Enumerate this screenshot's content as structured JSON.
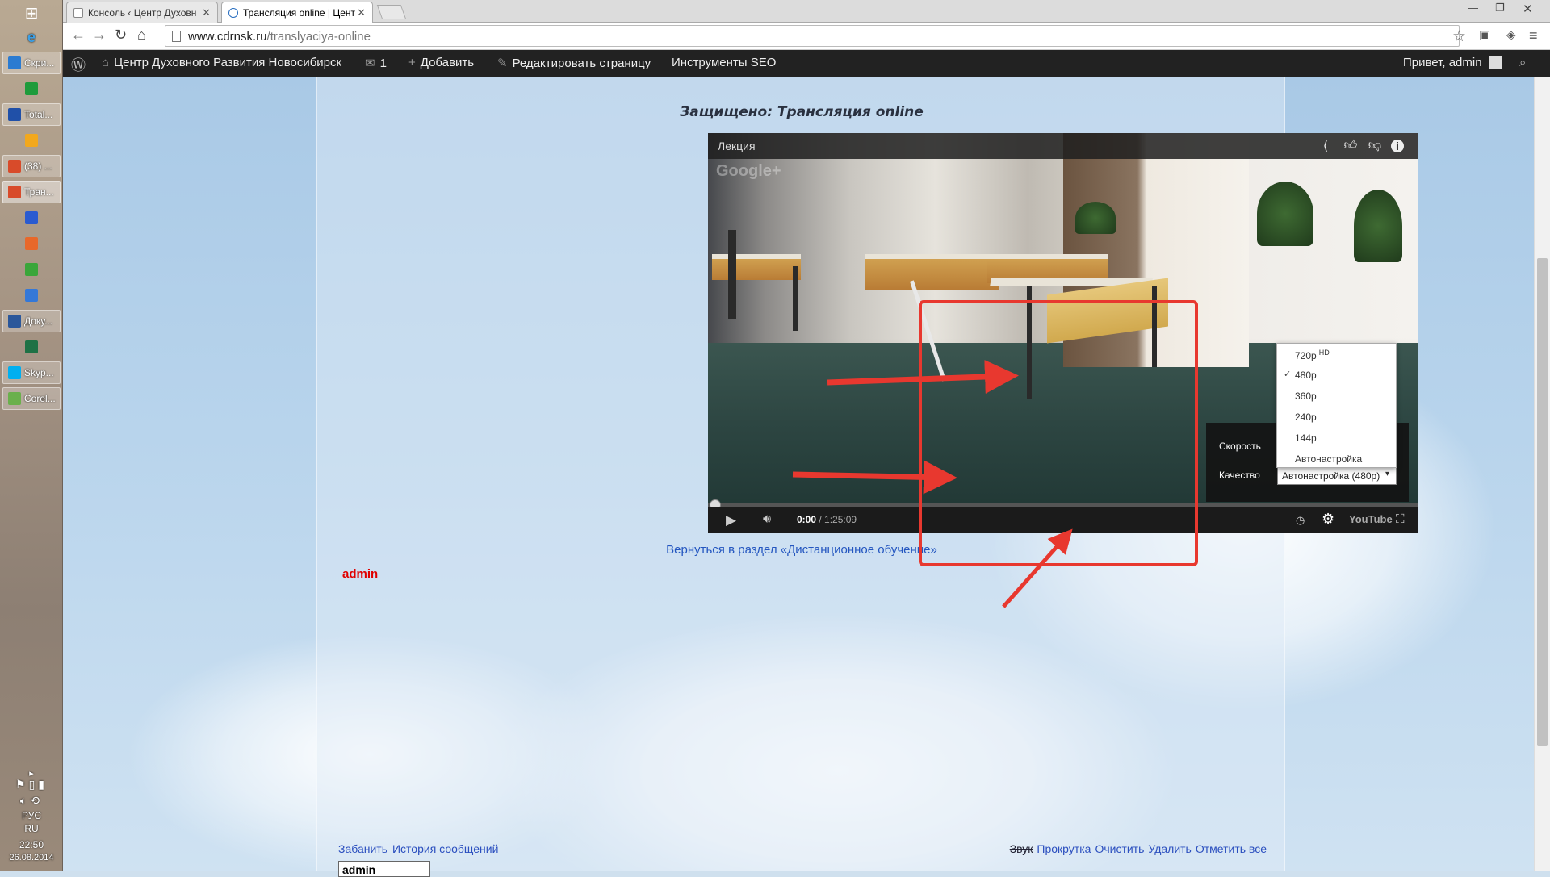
{
  "taskbar": {
    "items": [
      {
        "label": "Скри...",
        "color": "#2b7bd1",
        "button": true
      },
      {
        "label": "",
        "color": "#1e9b3b"
      },
      {
        "label": "Total...",
        "color": "#2050a8",
        "button": true
      },
      {
        "label": "",
        "color": "#f2a81d"
      },
      {
        "label": "(38) ...",
        "color": "#d84b2a",
        "button": true
      },
      {
        "label": "Тран...",
        "color": "#d84b2a",
        "button": true,
        "active": true
      },
      {
        "label": "",
        "color": "#2a5bd0"
      },
      {
        "label": "",
        "color": "#e8682a"
      },
      {
        "label": "",
        "color": "#3aa63a"
      },
      {
        "label": "",
        "color": "#3478d8"
      },
      {
        "label": "Доку...",
        "color": "#2b579a",
        "button": true
      },
      {
        "label": "",
        "color": "#1e7145"
      },
      {
        "label": "Skyp...",
        "color": "#00aff0",
        "button": true
      },
      {
        "label": "Corel...",
        "color": "#6ab04c",
        "button": true
      }
    ],
    "lang_line1": "РУС",
    "lang_line2": "RU",
    "time": "22:50",
    "date": "26.08.2014"
  },
  "browser": {
    "tabs": [
      {
        "title": "Консоль ‹ Центр Духовн",
        "active": false
      },
      {
        "title": "Трансляция online | Цент",
        "active": true
      }
    ],
    "url_host": "www.cdrnsk.ru",
    "url_path": "/translyaciya-online"
  },
  "adminbar": {
    "site_name": "Центр Духовного Развития Новосибирск",
    "comments_count": "1",
    "add_label": "Добавить",
    "edit_label": "Редактировать страницу",
    "seo_label": "Инструменты SEO",
    "greeting": "Привет, admin"
  },
  "page": {
    "title": "Защищено: Трансляция online",
    "back_link": "Вернуться в раздел «Дистанционное обучение»",
    "author": "admin"
  },
  "player": {
    "video_title": "Лекция",
    "watermark": "Google+",
    "time_current": "0:00",
    "time_total": "/ 1:25:09",
    "settings": {
      "speed_label": "Скорость",
      "quality_label": "Качество",
      "quality_selected": "Автонастройка (480p)"
    },
    "quality_options": [
      {
        "label": "720p",
        "badge": "HD",
        "checked": false
      },
      {
        "label": "480p",
        "badge": "",
        "checked": true
      },
      {
        "label": "360p",
        "badge": "",
        "checked": false
      },
      {
        "label": "240p",
        "badge": "",
        "checked": false
      },
      {
        "label": "144p",
        "badge": "",
        "checked": false
      },
      {
        "label": "Автонастройка",
        "badge": "",
        "checked": false
      }
    ],
    "youtube_label": "YouTube"
  },
  "chat": {
    "left_links": [
      "Забанить",
      "История сообщений"
    ],
    "right_links": [
      "Звук",
      "Прокрутка",
      "Очистить",
      "Удалить",
      "Отметить все"
    ],
    "input_value": "admin"
  },
  "colors": {
    "annotation": "#e8382f",
    "link": "#2456c0",
    "author": "#e00000"
  }
}
